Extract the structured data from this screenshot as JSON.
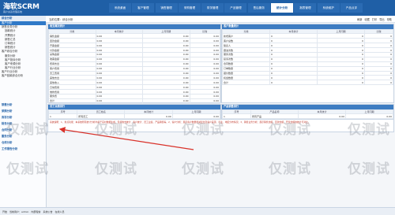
{
  "header": {
    "logo": "海软SCRM",
    "logo_sub": "客户关系管理系统",
    "top_links": "系统菜单 | 退出系统",
    "nav": [
      "系统桌面",
      "客户管理",
      "销售管理",
      "采购管理",
      "财务管理",
      "产品管理",
      "售后服务",
      "统计分析",
      "报表管理",
      "系统维护",
      "产品点评"
    ],
    "active_nav_index": 7
  },
  "sidebar": {
    "head": "综合分析",
    "items": [
      {
        "label": "客户分析",
        "level": 1,
        "selected": true
      },
      {
        "label": "销售业务分析",
        "level": 1
      },
      {
        "label": "回款统计",
        "level": 2
      },
      {
        "label": "开票统计",
        "level": 2
      },
      {
        "label": "销售汇总",
        "level": 2
      },
      {
        "label": "订单统计",
        "level": 2
      },
      {
        "label": "销售统计",
        "level": 2
      },
      {
        "label": "客户综合分析",
        "level": 1
      },
      {
        "label": "服务分析",
        "level": 2
      },
      {
        "label": "客户投诉分析",
        "level": 2
      },
      {
        "label": "客户来源分析",
        "level": 2
      },
      {
        "label": "客户行业分析",
        "level": 2
      },
      {
        "label": "客户行业分析",
        "level": 1
      },
      {
        "label": "客户回款综合分析",
        "level": 1
      }
    ],
    "groups": [
      "销售分析",
      "采购分析",
      "库存分析",
      "财务分析",
      "合同分析",
      "服务分析",
      "仓库分析",
      "工作报告分析"
    ]
  },
  "crumb": "当前位置：综合分析",
  "toolbar": [
    "刷新",
    "收藏",
    "打印",
    "导出",
    "帮助"
  ],
  "panel1": {
    "title": "收支概况统计",
    "columns": [
      "分类",
      "本月统计",
      "上月同期",
      "比较"
    ],
    "rows": [
      [
        "销售金额",
        "0.00",
        "0.00",
        "0.00"
      ],
      [
        "回款金额",
        "0.00",
        "0.00",
        "0.00"
      ],
      [
        "开票金额",
        "0.00",
        "0.00",
        "0.00"
      ],
      [
        "付款金额",
        "0.00",
        "0.00",
        "0.00"
      ],
      [
        "采购金额",
        "0.00",
        "0.00",
        "0.00"
      ],
      [
        "收票金额",
        "0.00",
        "0.00",
        "0.00"
      ],
      [
        "费用支出",
        "0.00",
        "0.00",
        "0.00"
      ],
      [
        "客户费用",
        "0.00",
        "0.00",
        "0.00"
      ],
      [
        "员工费用",
        "0.00",
        "0.00",
        "0.00"
      ],
      [
        "其他支出",
        "0.00",
        "0.00",
        "0.00"
      ],
      [
        "其他收入",
        "0.00",
        "0.00",
        "0.00"
      ],
      [
        "日常费用",
        "0.00",
        "0.00",
        "0.00"
      ],
      [
        "维修费用",
        "0.00",
        "0.00",
        "0.00"
      ],
      [
        "服务费",
        "0.00",
        "0.00",
        "0.00"
      ],
      [
        "合计",
        "0.00",
        "0.00",
        "0.00"
      ]
    ]
  },
  "panel2": {
    "title": "客户数量统计",
    "columns": [
      "分类",
      "本月统计",
      "上月同期",
      "比较"
    ],
    "rows": [
      [
        "新增客户",
        "0",
        "0",
        "0"
      ],
      [
        "客户总数",
        "0",
        "0",
        "0"
      ],
      [
        "联系人",
        "0",
        "0",
        "0"
      ],
      [
        "跟进次数",
        "0",
        "0",
        "0"
      ],
      [
        "服务次数",
        "0",
        "0",
        "0"
      ],
      [
        "投诉次数",
        "0",
        "0",
        "0"
      ],
      [
        "合同数量",
        "0",
        "0",
        "0"
      ],
      [
        "订单数量",
        "0",
        "0",
        "0"
      ],
      [
        "报价数量",
        "0",
        "0",
        "0"
      ],
      [
        "机会数量",
        "0",
        "0",
        "0"
      ],
      [
        "合计",
        "0",
        "0",
        "0"
      ]
    ]
  },
  "panel3": {
    "title": "员工业绩排行",
    "columns": [
      "序号",
      "员工姓名",
      "本月统计",
      "上月同期"
    ],
    "rows": [
      [
        "1",
        "所有员工",
        "0.00",
        "0.00"
      ]
    ]
  },
  "panel4": {
    "title": "产品销售排行",
    "columns": [
      "序号",
      "产品名称",
      "本月统计",
      "上月同期"
    ],
    "rows": [
      [
        "1",
        "所有产品",
        "0.00",
        "0.00"
      ]
    ]
  },
  "note": "系统说明：1、重点功能：本系统所有统计分析均基于实时数据生成，包括收支统计、客户统计、员工业绩、产品销售等。2、客户分析：展示客户数量增减变化及客户来源、行业、地区分布情况。3、销售业务分析：展示销售金额、回款金额、开票金额的统计与对比。",
  "watermark": "仅测试",
  "status": [
    "开始",
    "当前用户：admin",
    "内部短信",
    "系统公告",
    "在线人员"
  ],
  "colors": {
    "brand": "#1f5fa6",
    "accent": "#3d7cc2",
    "arrow": "#d9322a"
  }
}
